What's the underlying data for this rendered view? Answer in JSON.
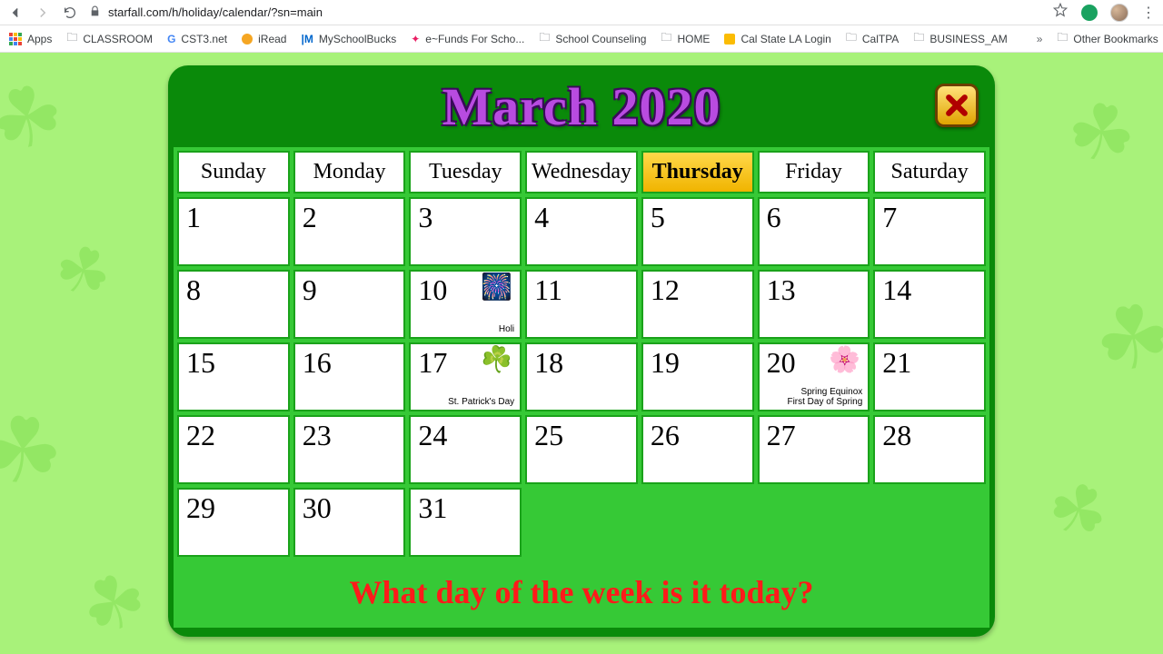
{
  "browser": {
    "url": "starfall.com/h/holiday/calendar/?sn=main"
  },
  "bookmarks": {
    "apps": "Apps",
    "items": [
      "CLASSROOM",
      "CST3.net",
      "iRead",
      "MySchoolBucks",
      "e~Funds For Scho...",
      "School Counseling",
      "HOME",
      "Cal State LA Login",
      "CalTPA",
      "BUSINESS_AM"
    ],
    "other": "Other Bookmarks"
  },
  "calendar": {
    "title": "March 2020",
    "day_headers": [
      "Sunday",
      "Monday",
      "Tuesday",
      "Wednesday",
      "Thursday",
      "Friday",
      "Saturday"
    ],
    "highlight_index": 4,
    "days": [
      {
        "n": "1"
      },
      {
        "n": "2"
      },
      {
        "n": "3"
      },
      {
        "n": "4"
      },
      {
        "n": "5"
      },
      {
        "n": "6"
      },
      {
        "n": "7"
      },
      {
        "n": "8"
      },
      {
        "n": "9"
      },
      {
        "n": "10",
        "event": "Holi",
        "icon": "fireworks"
      },
      {
        "n": "11"
      },
      {
        "n": "12"
      },
      {
        "n": "13"
      },
      {
        "n": "14"
      },
      {
        "n": "15"
      },
      {
        "n": "16"
      },
      {
        "n": "17",
        "event": "St. Patrick's Day",
        "icon": "shamrock"
      },
      {
        "n": "18"
      },
      {
        "n": "19"
      },
      {
        "n": "20",
        "event": "Spring Equinox\nFirst Day of Spring",
        "icon": "tree"
      },
      {
        "n": "21"
      },
      {
        "n": "22"
      },
      {
        "n": "23"
      },
      {
        "n": "24"
      },
      {
        "n": "25"
      },
      {
        "n": "26"
      },
      {
        "n": "27"
      },
      {
        "n": "28"
      },
      {
        "n": "29"
      },
      {
        "n": "30"
      },
      {
        "n": "31"
      }
    ],
    "prompt": "What day of the week is it today?"
  }
}
